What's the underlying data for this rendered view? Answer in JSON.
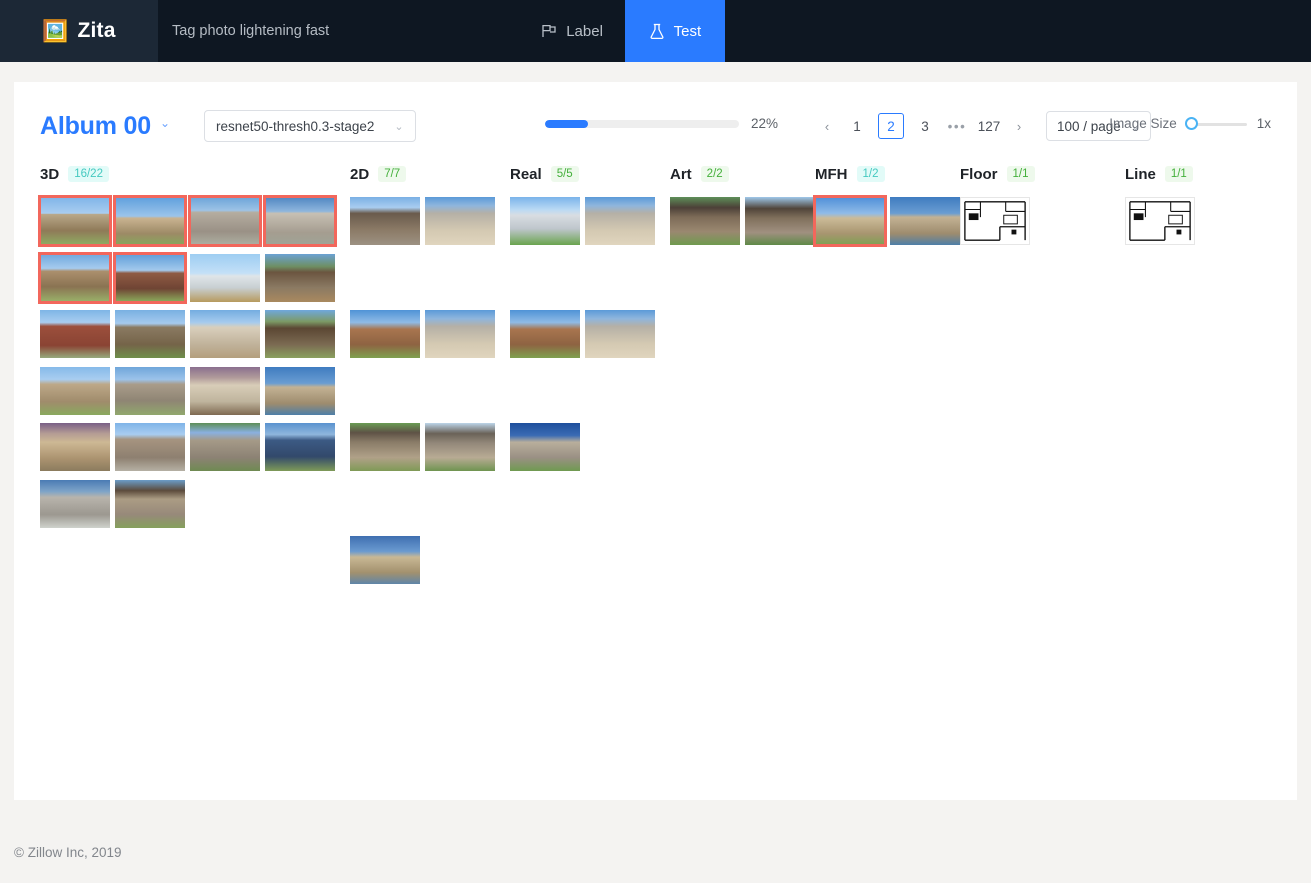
{
  "navbar": {
    "brand": {
      "name": "Zita",
      "icon": "framed-picture-icon"
    },
    "tagline": "Tag photo lightening fast",
    "items": [
      {
        "label": "Label",
        "icon": "tag-icon",
        "active": false
      },
      {
        "label": "Test",
        "icon": "flask-icon",
        "active": true
      }
    ]
  },
  "toolbar": {
    "album_title": "Album 00",
    "album_caret": "⌄",
    "model_select": {
      "value": "resnet50-thresh0.3-stage2",
      "caret": "⌄"
    },
    "progress": {
      "percent": 22,
      "label": "22%"
    },
    "pagination": {
      "prev": "‹",
      "next": "›",
      "pages": [
        "1",
        "2",
        "3"
      ],
      "current": "2",
      "ellipsis": "•••",
      "last": "127"
    },
    "page_size": {
      "value": "100 / page",
      "caret": "⌄"
    },
    "image_size": {
      "label": "Image Size",
      "value": "1x"
    }
  },
  "columns": [
    {
      "name": "3D",
      "badge": "16/22",
      "badge_state": "partial",
      "cols": 4,
      "images": [
        {
          "row": 0,
          "col": 0,
          "selected": true,
          "style": "linear-gradient(180deg,#7fb4e8 0%,#a9cdf0 34%,#b9a88a 36%,#8f7a58 70%,#8fae62 100%)"
        },
        {
          "row": 0,
          "col": 1,
          "selected": true,
          "style": "linear-gradient(180deg,#5f9fdd 0%,#9bc4ea 40%,#c9b391 44%,#9d8a66 76%,#87a75c 100%)"
        },
        {
          "row": 0,
          "col": 2,
          "selected": true,
          "style": "linear-gradient(180deg,#6ca4d8 0%,#9dc3e6 28%,#b5ada0 32%,#9a9186 72%,#adb0a2 100%)"
        },
        {
          "row": 0,
          "col": 3,
          "selected": true,
          "style": "linear-gradient(180deg,#4f86c2 0%,#8fb6dd 30%,#c7c0b4 34%,#a59d90 74%,#9fa496 100%)"
        },
        {
          "row": 1,
          "col": 0,
          "selected": true,
          "style": "linear-gradient(180deg,#6ea8dd 0%,#a6cbee 30%,#ab8f6d 36%,#8a7352 68%,#9ab26a 100%)"
        },
        {
          "row": 1,
          "col": 1,
          "selected": true,
          "style": "linear-gradient(180deg,#5e9ed9 0%,#a3c9ec 34%,#8f5b44 40%,#6f4434 72%,#8bae5d 100%)"
        },
        {
          "row": 1,
          "col": 2,
          "selected": false,
          "style": "linear-gradient(180deg,#9ecdf2 0%,#c3e0f7 40%,#dfe5e8 46%,#c8cfd2 70%,#b79a5e 100%)"
        },
        {
          "row": 1,
          "col": 3,
          "selected": false,
          "style": "linear-gradient(180deg,#6ba2d4 0%,#6e8f63 26%,#6b5540 38%,#8b7a63 70%,#a9895f 100%)"
        },
        {
          "row": 2,
          "col": 0,
          "selected": false,
          "style": "linear-gradient(180deg,#7eb5e6 0%,#a9cdf0 26%,#9c4f3c 34%,#8a4434 74%,#96a97c 100%)"
        },
        {
          "row": 2,
          "col": 1,
          "selected": false,
          "style": "linear-gradient(180deg,#79b0e2 0%,#a5caee 28%,#8a7a62 36%,#756449 72%,#6f8f4a 100%)"
        },
        {
          "row": 2,
          "col": 2,
          "selected": false,
          "style": "linear-gradient(180deg,#74ade0 0%,#a6cbee 26%,#d9cfbc 36%,#c0b29a 72%,#b49f7d 100%)"
        },
        {
          "row": 2,
          "col": 3,
          "selected": false,
          "style": "linear-gradient(180deg,#6fa8dc 0%,#7c9a66 24%,#5b4733 38%,#7b6a52 72%,#8aa05e 100%)"
        },
        {
          "row": 3,
          "col": 0,
          "selected": false,
          "style": "linear-gradient(180deg,#86bae9 0%,#a9cdf0 26%,#bda888 36%,#a08c6c 72%,#8aa95e 100%)"
        },
        {
          "row": 3,
          "col": 1,
          "selected": false,
          "style": "linear-gradient(180deg,#6fa6da 0%,#9cc3ea 26%,#a99c8a 36%,#8f8574 70%,#91a86d 100%)"
        },
        {
          "row": 3,
          "col": 2,
          "selected": false,
          "style": "linear-gradient(180deg,#8a6f8e 0%,#b09a9a 22%,#d8cdb8 38%,#bfb49d 72%,#7f6a52 100%)"
        },
        {
          "row": 3,
          "col": 3,
          "selected": false,
          "style": "linear-gradient(180deg,#3f7cc0 0%,#6a9dd2 34%,#c3b294 42%,#9e8c6e 76%,#4d7fa8 100%)"
        },
        {
          "row": 4,
          "col": 0,
          "selected": false,
          "style": "linear-gradient(180deg,#7a5f86 0%,#b49c94 22%,#cdb894 40%,#ab9370 74%,#8b7b5e 100%)"
        },
        {
          "row": 4,
          "col": 1,
          "selected": false,
          "style": "linear-gradient(180deg,#7fb4e8 0%,#a9cdf0 24%,#a69480 34%,#8e8070 72%,#b5b0a4 100%)"
        },
        {
          "row": 4,
          "col": 2,
          "selected": false,
          "style": "linear-gradient(180deg,#5e8f58 0%,#8ab0e0 20%,#a59a88 36%,#8c8274 72%,#6f8a52 100%)"
        },
        {
          "row": 4,
          "col": 3,
          "selected": false,
          "style": "linear-gradient(180deg,#5a93cf 0%,#8fb6dd 24%,#3c5a84 36%,#32496b 70%,#7e9a58 100%)"
        },
        {
          "row": 5,
          "col": 0,
          "selected": false,
          "style": "linear-gradient(180deg,#4a7bb4 0%,#7ea4c8 24%,#b8b4ac 36%,#9c9890 72%,#cfd2cc 100%)"
        },
        {
          "row": 5,
          "col": 1,
          "selected": false,
          "style": "linear-gradient(180deg,#6b9cc8 0%,#5c4b3c 22%,#ab9c84 40%,#97897a 72%,#86a05c 100%)"
        }
      ]
    },
    {
      "name": "2D",
      "badge": "7/7",
      "badge_state": "complete",
      "cols": 4,
      "images": [
        {
          "row": 0,
          "col": 0,
          "selected": false,
          "style": "linear-gradient(180deg,#7ab0e4 0%,#a9cdf0 22%,#6a5b4c 34%,#8b7a66 68%,#9c9182 100%)"
        },
        {
          "row": 0,
          "col": 1,
          "selected": false,
          "style": "linear-gradient(180deg,#5b9ad8 0%,#8fb6dd 18%,#b5b0a6 34%,#d4c9b2 70%,#e0d5be 100%)"
        },
        {
          "row": 2,
          "col": 0,
          "selected": false,
          "style": "linear-gradient(180deg,#4f93d6 0%,#8fbbe6 26%,#a8754f 40%,#8e6342 72%,#7fa04f 100%)"
        },
        {
          "row": 2,
          "col": 1,
          "selected": false,
          "style": "linear-gradient(180deg,#5b9ad8 0%,#8fb6dd 18%,#b5b0a6 34%,#d4c9b2 70%,#e0d5be 100%)"
        },
        {
          "row": 4,
          "col": 0,
          "selected": false,
          "style": "linear-gradient(180deg,#6a9c54 0%,#5e5246 20%,#8a7c68 40%,#b0a188 72%,#7f9a56 100%)"
        },
        {
          "row": 4,
          "col": 1,
          "selected": false,
          "style": "linear-gradient(180deg,#bcd4e8 0%,#6a6258 22%,#93887a 42%,#b8ab94 72%,#6f9450 100%)"
        },
        {
          "row": 6,
          "col": 0,
          "selected": false,
          "style": "linear-gradient(180deg,#3f6fb0 0%,#6a9ad0 32%,#c8b895 44%,#a3916e 76%,#5f86a8 100%)"
        }
      ]
    },
    {
      "name": "Real",
      "badge": "5/5",
      "badge_state": "complete",
      "cols": 4,
      "images": [
        {
          "row": 0,
          "col": 0,
          "selected": false,
          "style": "linear-gradient(180deg,#7ab4ea 0%,#b9d9f4 26%,#d8dde2 38%,#bfc6cc 66%,#6aa44e 100%)"
        },
        {
          "row": 0,
          "col": 1,
          "selected": false,
          "style": "linear-gradient(180deg,#5b9ad8 0%,#8fb6dd 18%,#b5b0a6 34%,#d4c9b2 70%,#e0d5be 100%)"
        },
        {
          "row": 2,
          "col": 0,
          "selected": false,
          "style": "linear-gradient(180deg,#4f93d6 0%,#8fbbe6 26%,#a8754f 40%,#8e6342 72%,#7fa04f 100%)"
        },
        {
          "row": 2,
          "col": 1,
          "selected": false,
          "style": "linear-gradient(180deg,#5b9ad8 0%,#8fb6dd 18%,#b5b0a6 34%,#d4c9b2 70%,#e0d5be 100%)"
        },
        {
          "row": 4,
          "col": 0,
          "selected": false,
          "style": "linear-gradient(180deg,#1e4f9c 0%,#3a6bb4 26%,#b8ae9c 40%,#9a9084 72%,#6f9a50 100%)"
        }
      ]
    },
    {
      "name": "Art",
      "badge": "2/2",
      "badge_state": "complete",
      "cols": 4,
      "images": [
        {
          "row": 0,
          "col": 0,
          "selected": false,
          "style": "linear-gradient(180deg,#5e8f58 0%,#4c4038 22%,#7d6c58 42%,#9a8870 72%,#6f9a4e 100%)"
        },
        {
          "row": 0,
          "col": 1,
          "selected": false,
          "style": "linear-gradient(180deg,#9fc8ea 0%,#50443a 24%,#80705c 44%,#a09080 74%,#5f8a48 100%)"
        }
      ]
    },
    {
      "name": "MFH",
      "badge": "1/2",
      "badge_state": "partial",
      "cols": 4,
      "images": [
        {
          "row": 0,
          "col": 0,
          "selected": true,
          "style": "linear-gradient(180deg,#4f8fd8 0%,#8fbbe8 34%,#cbbb98 44%,#a89570 76%,#7fa052 100%)"
        },
        {
          "row": 0,
          "col": 1,
          "selected": false,
          "style": "linear-gradient(180deg,#3f7cc0 0%,#6a9dd2 34%,#c3b294 42%,#9e8c6e 76%,#4d7fa8 100%)"
        }
      ]
    },
    {
      "name": "Floor",
      "badge": "1/1",
      "badge_state": "complete",
      "cols": 4,
      "images": [
        {
          "row": 0,
          "col": 0,
          "selected": false,
          "style": "floorplan"
        }
      ]
    },
    {
      "name": "Line",
      "badge": "1/1",
      "badge_state": "complete",
      "cols": 4,
      "images": [
        {
          "row": 0,
          "col": 0,
          "selected": false,
          "style": "floorplan"
        }
      ]
    }
  ],
  "footer": {
    "copyright": "© Zillow Inc, 2019"
  },
  "colors": {
    "accent": "#2a7bff",
    "navbar": "#0e1722",
    "brand_block": "#1c2836",
    "selection": "#f2675c",
    "badge_complete": "#44b03b",
    "badge_partial": "#45c9c0"
  }
}
